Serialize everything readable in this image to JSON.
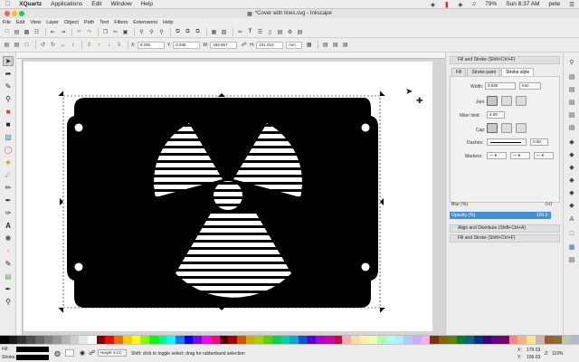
{
  "mac_menubar": {
    "app_name": "XQuartz",
    "menus": [
      "Applications",
      "Edit",
      "Window",
      "Help"
    ],
    "clock": "Sun 8:37 AM",
    "battery": "79%",
    "user": "pete"
  },
  "window": {
    "title": "*Cover with lines.svg - Inkscape"
  },
  "app_menu": [
    "File",
    "Edit",
    "View",
    "Layer",
    "Object",
    "Path",
    "Text",
    "Filters",
    "Extensions",
    "Help"
  ],
  "tool_controls": {
    "x_label": "X:",
    "x_value": "0.035",
    "y_label": "Y:",
    "y_value": "0.035",
    "w_label": "W:",
    "w_value": "159.967",
    "h_label": "H:",
    "h_value": "101.010",
    "unit": "mm"
  },
  "fill_stroke": {
    "tabs": [
      "Fill",
      "Stroke paint",
      "Stroke style"
    ],
    "width_label": "Width:",
    "width_value": "0.030",
    "width_unit": "mm",
    "join_label": "Join:",
    "miter_label": "Miter limit:",
    "miter_value": "4.00",
    "cap_label": "Cap:",
    "dashes_label": "Dashes:",
    "dashes_value": "0.00",
    "markers_label": "Markers:",
    "blur_label": "Blur (%)",
    "blur_value": "0.0",
    "opacity_label": "Opacity (%)",
    "opacity_value": "100.0"
  },
  "dock_panels": {
    "fill_and_stroke_header": "Fill and Stroke (Shift+Ctrl+F)",
    "align_header": "Align and Distribute (Shift+Ctrl+A)",
    "fill_and_stroke_bottom": "Fill and Stroke (Shift+Ctrl+F)"
  },
  "statusbar": {
    "fill_label": "Fill:",
    "stroke_label": "Stroke:",
    "layer_value": "•Layer 4 LC",
    "message": "Shift: click to toggle select; drag for rubberband selection",
    "x_coord": "179.03",
    "y_coord": "106.03",
    "zoom": "119%",
    "x_label": "X:",
    "y_label": "Y:",
    "z_label": "Z:"
  },
  "colors": {
    "accent_blue": "#3f8ee0",
    "selection": "#000000"
  }
}
